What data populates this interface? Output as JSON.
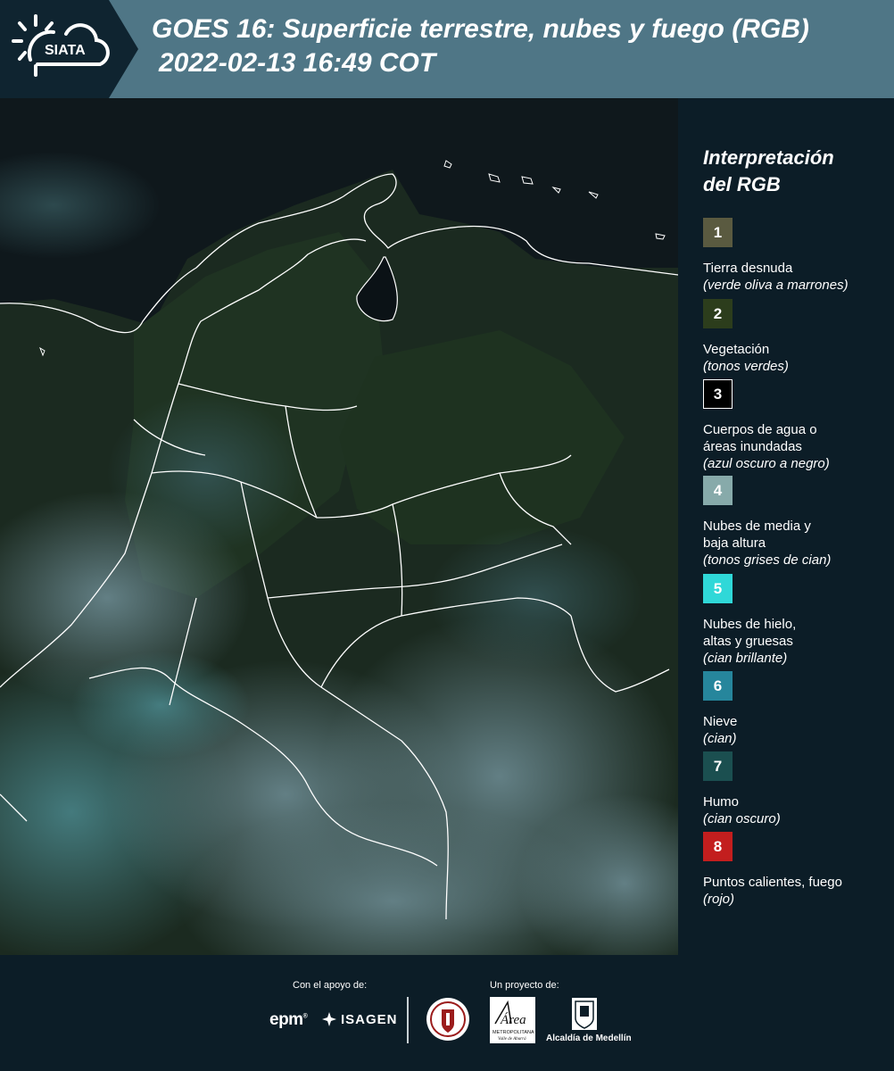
{
  "header": {
    "logo_text": "SIATA",
    "title_line1": "GOES 16: Superficie terrestre, nubes y fuego (RGB)",
    "title_line2": "2022-02-13 16:49 COT"
  },
  "legend": {
    "title_line1": "Interpretación",
    "title_line2": "del RGB",
    "items": [
      {
        "number": "1",
        "color": "#5a5a40",
        "border": "#5a5a40",
        "line1": "Tierra desnuda",
        "line2": "",
        "note": "(verde oliva a marrones)"
      },
      {
        "number": "2",
        "color": "#2c3d1c",
        "border": "#2c3d1c",
        "line1": "Vegetación",
        "line2": "",
        "note": "(tonos verdes)"
      },
      {
        "number": "3",
        "color": "#000000",
        "border": "#ffffff",
        "line1": "Cuerpos de agua o",
        "line2": "áreas inundadas",
        "note": "(azul oscuro a negro)"
      },
      {
        "number": "4",
        "color": "#87aaaa",
        "border": "#87aaaa",
        "line1": "Nubes de media y",
        "line2": "baja altura",
        "note": "(tonos grises de cian)"
      },
      {
        "number": "5",
        "color": "#2fd8d8",
        "border": "#2fd8d8",
        "line1": "Nubes de hielo,",
        "line2": "altas y gruesas",
        "note": "(cian brillante)"
      },
      {
        "number": "6",
        "color": "#26869c",
        "border": "#26869c",
        "line1": "Nieve",
        "line2": "",
        "note": "(cian)"
      },
      {
        "number": "7",
        "color": "#1b4f50",
        "border": "#1b4f50",
        "line1": "Humo",
        "line2": "",
        "note": "(cian oscuro)"
      },
      {
        "number": "8",
        "color": "#c31e1e",
        "border": "#c31e1e",
        "line1": "Puntos calientes, fuego",
        "line2": "",
        "note": "(rojo)"
      }
    ]
  },
  "footer": {
    "support_label": "Con el apoyo de:",
    "project_label": "Un proyecto de:",
    "epm_logo": "epm",
    "isagen_logo": "ISAGEN",
    "amva_logo": "Área",
    "amva_sub1": "METROPOLITANA",
    "amva_sub2": "Valle de Aburrá",
    "alcaldia_logo": "Alcaldía de Medellín"
  }
}
